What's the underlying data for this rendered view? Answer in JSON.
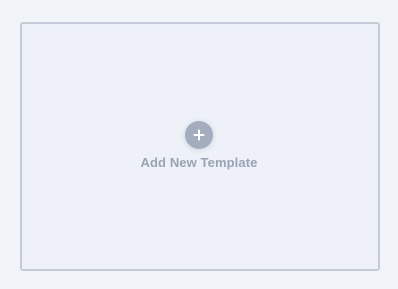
{
  "add_template": {
    "label": "Add New Template",
    "icon": "plus-icon"
  },
  "colors": {
    "background": "#f1f4f9",
    "card_fill": "#eef2f8",
    "card_border": "#c3cbd8",
    "icon_circle": "#a4adbd",
    "icon_glyph": "#ffffff",
    "label_text": "#9aa3b3"
  }
}
